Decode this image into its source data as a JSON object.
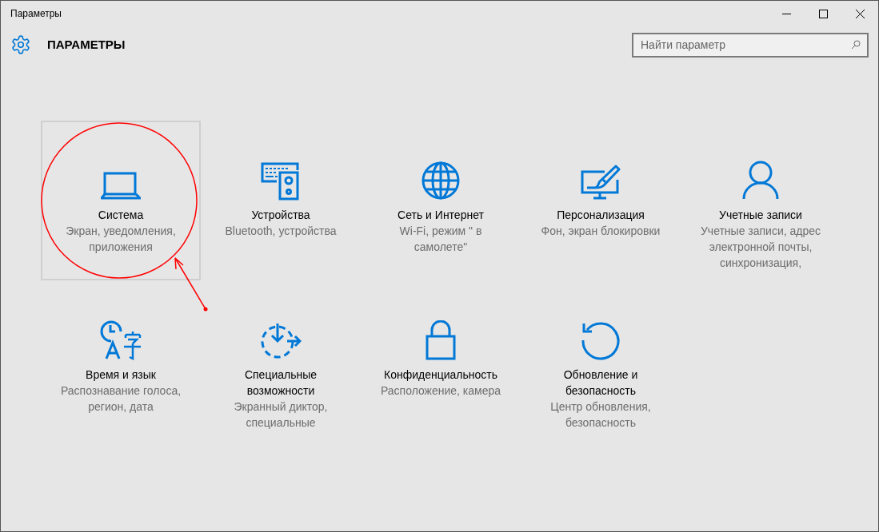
{
  "window": {
    "title": "Параметры"
  },
  "header": {
    "title": "ПАРАМЕТРЫ"
  },
  "search": {
    "placeholder": "Найти параметр"
  },
  "tiles": [
    {
      "title": "Система",
      "subtitle": "Экран, уведомления, приложения",
      "selected": true
    },
    {
      "title": "Устройства",
      "subtitle": "Bluetooth, устройства",
      "selected": false
    },
    {
      "title": "Сеть и Интернет",
      "subtitle": "Wi-Fi, режим \" в самолете\"",
      "selected": false
    },
    {
      "title": "Персонализация",
      "subtitle": "Фон, экран блокировки",
      "selected": false
    },
    {
      "title": "Учетные записи",
      "subtitle": "Учетные записи, адрес электронной почты, синхронизация,",
      "selected": false
    },
    {
      "title": "Время и язык",
      "subtitle": "Распознавание голоса, регион, дата",
      "selected": false
    },
    {
      "title": "Специальные возможности",
      "subtitle": "Экранный диктор, специальные",
      "selected": false
    },
    {
      "title": "Конфиденциальность",
      "subtitle": "Расположение, камера",
      "selected": false
    },
    {
      "title": "Обновление и безопасность",
      "subtitle": "Центр обновления, безопасность",
      "selected": false
    }
  ]
}
